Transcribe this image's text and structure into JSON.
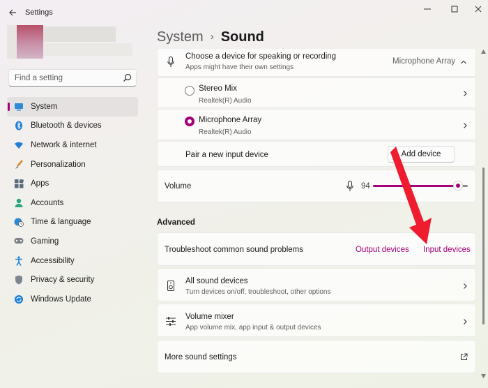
{
  "window": {
    "title": "Settings",
    "back_icon": "arrow-left-icon",
    "controls": [
      "minimize-icon",
      "maximize-icon",
      "close-icon"
    ]
  },
  "search": {
    "placeholder": "Find a setting"
  },
  "sidebar": {
    "items": [
      {
        "label": "System",
        "icon": "monitor-icon",
        "active": true
      },
      {
        "label": "Bluetooth & devices",
        "icon": "bluetooth-icon"
      },
      {
        "label": "Network & internet",
        "icon": "wifi-icon"
      },
      {
        "label": "Personalization",
        "icon": "brush-icon"
      },
      {
        "label": "Apps",
        "icon": "apps-icon"
      },
      {
        "label": "Accounts",
        "icon": "person-icon"
      },
      {
        "label": "Time & language",
        "icon": "globe-clock-icon"
      },
      {
        "label": "Gaming",
        "icon": "gamepad-icon"
      },
      {
        "label": "Accessibility",
        "icon": "accessibility-icon"
      },
      {
        "label": "Privacy & security",
        "icon": "shield-icon"
      },
      {
        "label": "Windows Update",
        "icon": "update-icon"
      }
    ]
  },
  "breadcrumb": {
    "parent": "System",
    "separator": "›",
    "current": "Sound"
  },
  "input": {
    "title": "Choose a device for speaking or recording",
    "subtitle": "Apps might have their own settings",
    "selected_value": "Microphone Array",
    "devices": [
      {
        "name": "Stereo Mix",
        "driver": "Realtek(R) Audio",
        "selected": false
      },
      {
        "name": "Microphone Array",
        "driver": "Realtek(R) Audio",
        "selected": true
      }
    ],
    "pair_label": "Pair a new input device",
    "add_button": "Add device"
  },
  "volume": {
    "label": "Volume",
    "value": "94",
    "level_percent": 94
  },
  "advanced": {
    "heading": "Advanced",
    "troubleshoot_label": "Troubleshoot common sound problems",
    "output_link": "Output devices",
    "input_link": "Input devices",
    "all_devices_title": "All sound devices",
    "all_devices_sub": "Turn devices on/off, troubleshoot, other options",
    "mixer_title": "Volume mixer",
    "mixer_sub": "App volume mix, app input & output devices",
    "more_settings": "More sound settings"
  },
  "colors": {
    "accent": "#a3007a",
    "annotation_arrow": "#ee1c2e"
  }
}
